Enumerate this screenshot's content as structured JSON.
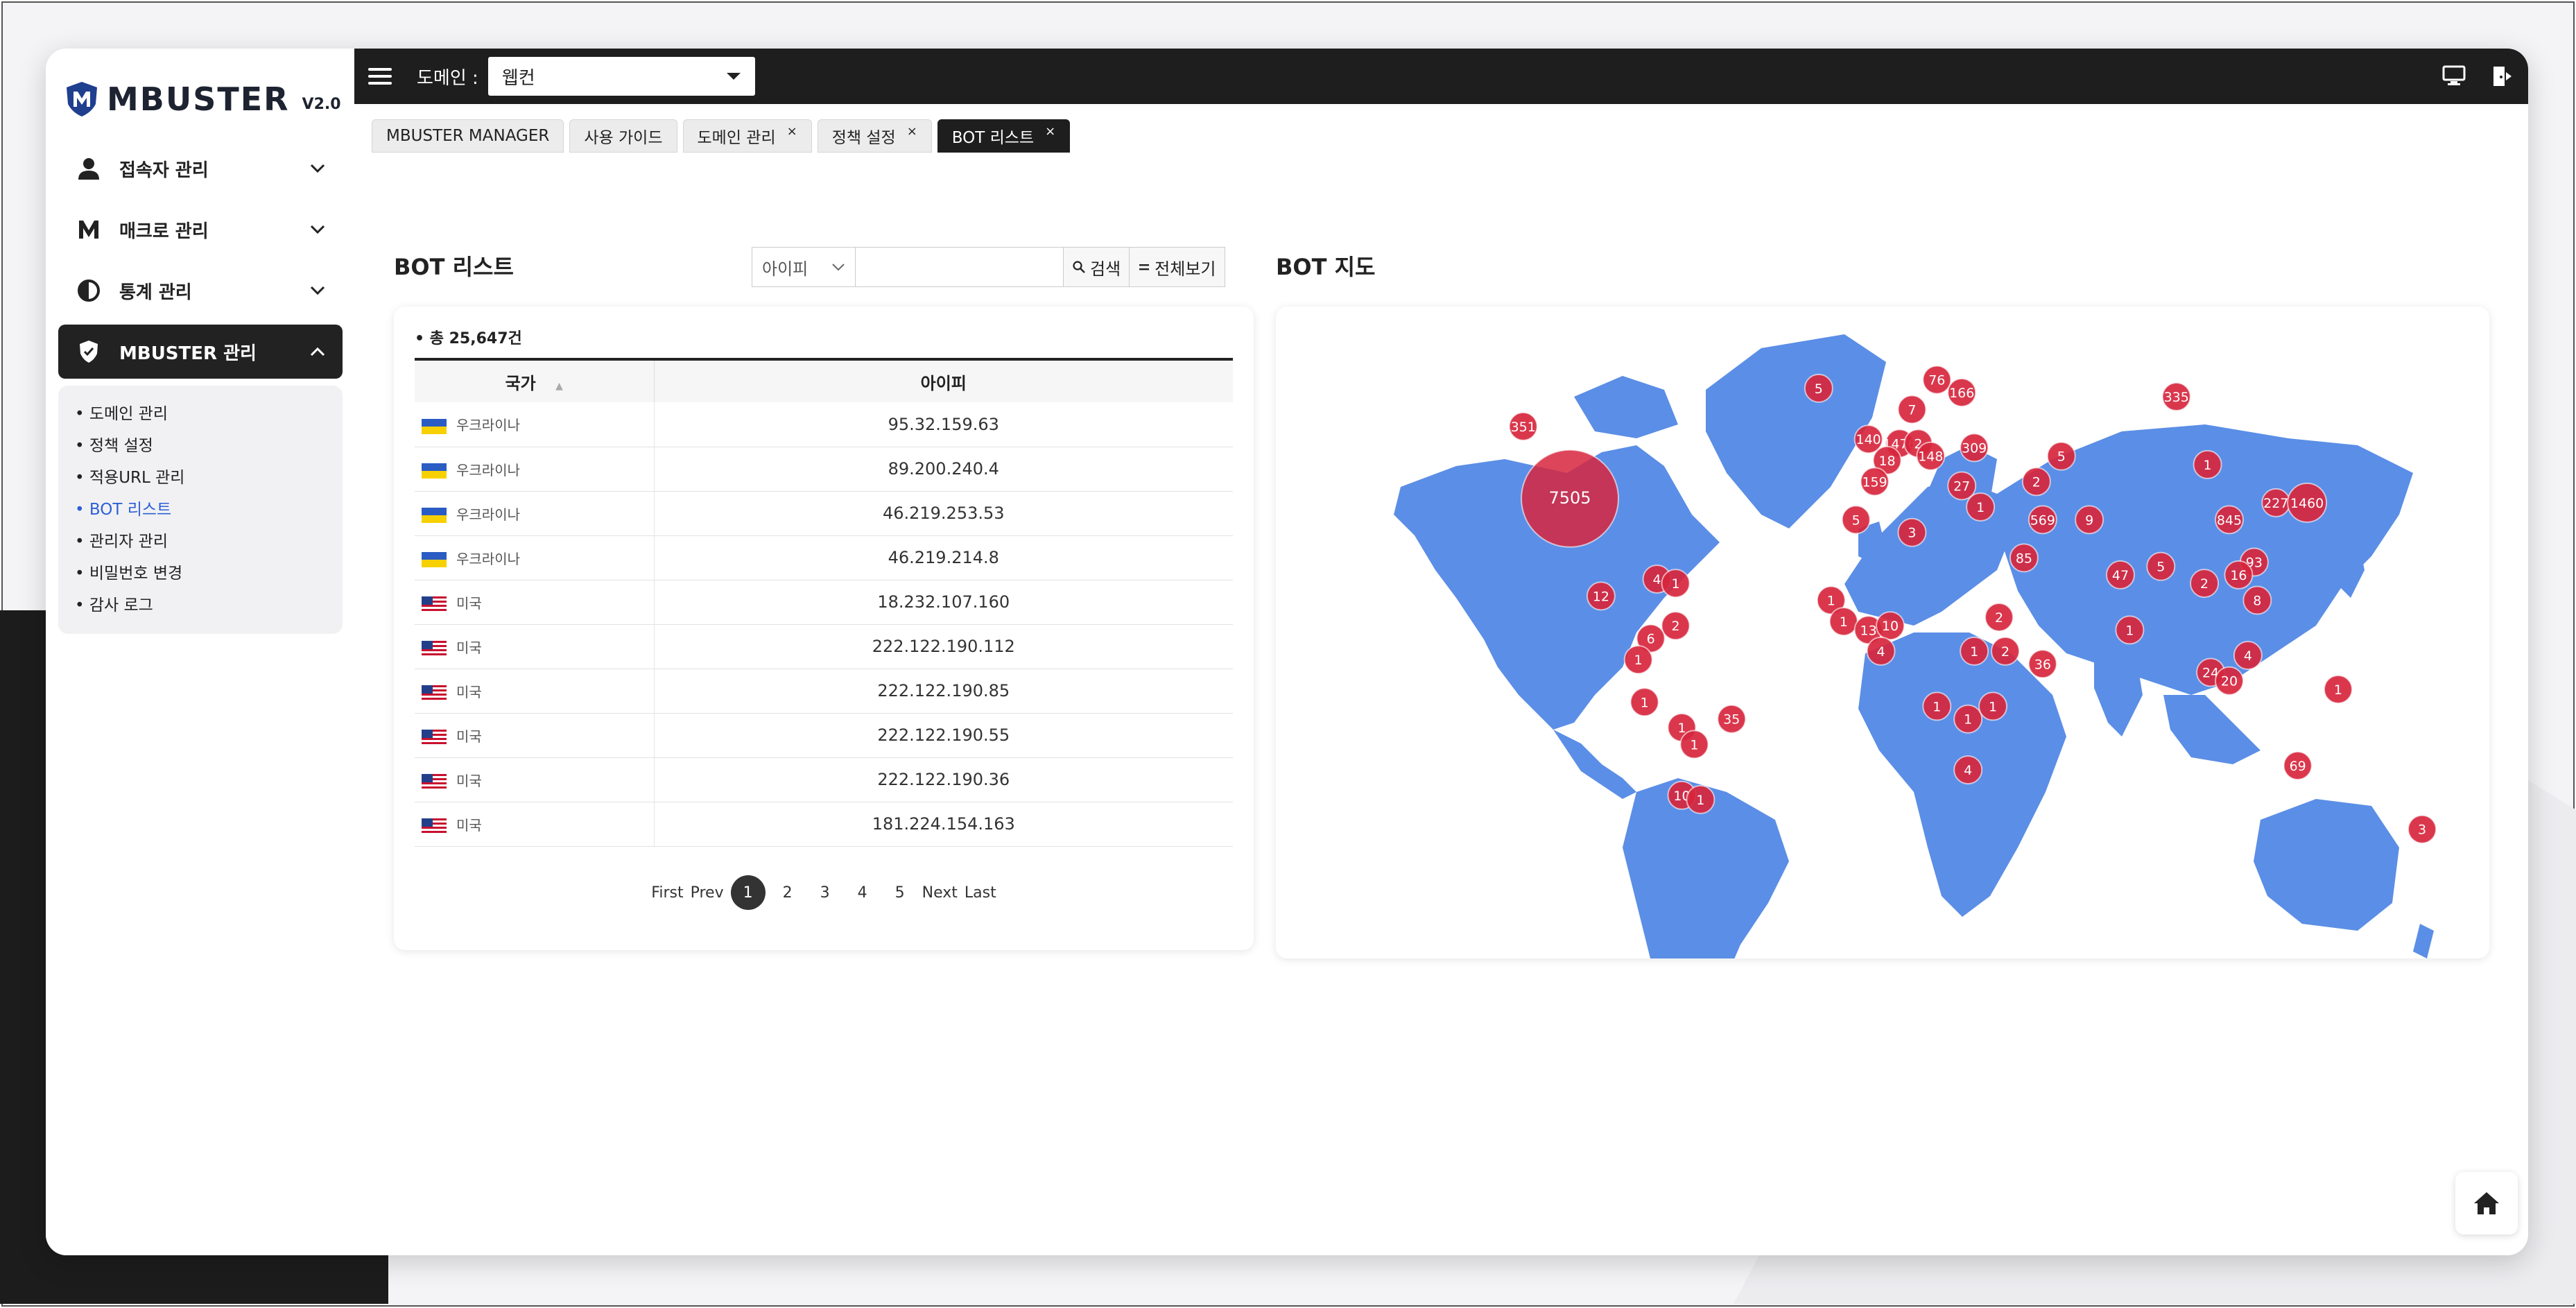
{
  "app": {
    "logo_text": "MBUSTER",
    "logo_version": "V2.0"
  },
  "sidebar": {
    "items": [
      {
        "label": "접속자 관리",
        "icon": "user-icon"
      },
      {
        "label": "매크로 관리",
        "icon": "m-letter-icon"
      },
      {
        "label": "통계 관리",
        "icon": "pie-chart-icon"
      },
      {
        "label": "MBUSTER 관리",
        "icon": "shield-icon",
        "active": true
      }
    ],
    "submenu": [
      "• 도메인 관리",
      "• 정책 설정",
      "• 적용URL 관리",
      "• BOT 리스트",
      "• 관리자 관리",
      "• 비밀번호 변경",
      "• 감사 로그"
    ],
    "submenu_active_index": 3
  },
  "topbar": {
    "domain_label": "도메인 :",
    "domain_value": "웹컨"
  },
  "tabs": [
    {
      "label": "MBUSTER MANAGER",
      "closable": false
    },
    {
      "label": "사용 가이드",
      "closable": false
    },
    {
      "label": "도메인 관리",
      "closable": true
    },
    {
      "label": "정책 설정",
      "closable": true
    },
    {
      "label": "BOT 리스트",
      "closable": true,
      "active": true
    }
  ],
  "tab_close_glyph": "×",
  "bot_list": {
    "title": "BOT 리스트",
    "search_select": "아이피",
    "search_placeholder": "",
    "search_button": "검색",
    "view_all_button": "전체보기",
    "total": "• 총 25,647건",
    "columns": [
      "국가",
      "아이피"
    ],
    "rows": [
      {
        "country": "우크라이나",
        "flag": "ua",
        "ip": "95.32.159.63"
      },
      {
        "country": "우크라이나",
        "flag": "ua",
        "ip": "89.200.240.4"
      },
      {
        "country": "우크라이나",
        "flag": "ua",
        "ip": "46.219.253.53"
      },
      {
        "country": "우크라이나",
        "flag": "ua",
        "ip": "46.219.214.8"
      },
      {
        "country": "미국",
        "flag": "us",
        "ip": "18.232.107.160"
      },
      {
        "country": "미국",
        "flag": "us",
        "ip": "222.122.190.112"
      },
      {
        "country": "미국",
        "flag": "us",
        "ip": "222.122.190.85"
      },
      {
        "country": "미국",
        "flag": "us",
        "ip": "222.122.190.55"
      },
      {
        "country": "미국",
        "flag": "us",
        "ip": "222.122.190.36"
      },
      {
        "country": "미국",
        "flag": "us",
        "ip": "181.224.154.163"
      }
    ],
    "pager": {
      "first": "First",
      "prev": "Prev",
      "pages": [
        "1",
        "2",
        "3",
        "4",
        "5"
      ],
      "current": "1",
      "next": "Next",
      "last": "Last"
    }
  },
  "bot_map": {
    "title": "BOT 지도",
    "land_color": "#5b8ee6",
    "marker_color": "#d7263d",
    "clusters": [
      {
        "label": "7505",
        "lon": -100,
        "lat": 38,
        "size": "large"
      },
      {
        "label": "351",
        "lon": -115,
        "lat": 55,
        "size": "small"
      },
      {
        "label": "5",
        "lon": -20,
        "lat": 64,
        "size": "small"
      },
      {
        "label": "76",
        "lon": 18,
        "lat": 66,
        "size": "small"
      },
      {
        "label": "166",
        "lon": 26,
        "lat": 63,
        "size": "small"
      },
      {
        "label": "7",
        "lon": 10,
        "lat": 59,
        "size": "small"
      },
      {
        "label": "335",
        "lon": 95,
        "lat": 62,
        "size": "small"
      },
      {
        "label": "140",
        "lon": -4,
        "lat": 52,
        "size": "small"
      },
      {
        "label": "1476",
        "lon": 6,
        "lat": 51,
        "size": "small"
      },
      {
        "label": "2",
        "lon": 12,
        "lat": 51,
        "size": "small"
      },
      {
        "label": "309",
        "lon": 30,
        "lat": 50,
        "size": "small"
      },
      {
        "label": "148",
        "lon": 16,
        "lat": 48,
        "size": "small"
      },
      {
        "label": "18",
        "lon": 2,
        "lat": 47,
        "size": "small"
      },
      {
        "label": "159",
        "lon": -2,
        "lat": 42,
        "size": "small"
      },
      {
        "label": "27",
        "lon": 26,
        "lat": 41,
        "size": "small"
      },
      {
        "label": "5",
        "lon": 58,
        "lat": 48,
        "size": "small"
      },
      {
        "label": "2",
        "lon": 50,
        "lat": 42,
        "size": "small"
      },
      {
        "label": "1",
        "lon": 105,
        "lat": 46,
        "size": "small"
      },
      {
        "label": "5",
        "lon": -8,
        "lat": 33,
        "size": "small"
      },
      {
        "label": "3",
        "lon": 10,
        "lat": 30,
        "size": "small"
      },
      {
        "label": "1",
        "lon": 32,
        "lat": 36,
        "size": "small"
      },
      {
        "label": "569",
        "lon": 52,
        "lat": 33,
        "size": "small"
      },
      {
        "label": "9",
        "lon": 67,
        "lat": 33,
        "size": "small"
      },
      {
        "label": "845",
        "lon": 112,
        "lat": 33,
        "size": "small"
      },
      {
        "label": "227",
        "lon": 127,
        "lat": 37,
        "size": "small"
      },
      {
        "label": "1460",
        "lon": 137,
        "lat": 37,
        "size": "medium"
      },
      {
        "label": "85",
        "lon": 46,
        "lat": 24,
        "size": "small"
      },
      {
        "label": "47",
        "lon": 77,
        "lat": 20,
        "size": "small"
      },
      {
        "label": "5",
        "lon": 90,
        "lat": 22,
        "size": "small"
      },
      {
        "label": "93",
        "lon": 120,
        "lat": 23,
        "size": "small"
      },
      {
        "label": "16",
        "lon": 115,
        "lat": 20,
        "size": "small"
      },
      {
        "label": "2",
        "lon": 104,
        "lat": 18,
        "size": "small"
      },
      {
        "label": "8",
        "lon": 121,
        "lat": 14,
        "size": "small"
      },
      {
        "label": "1",
        "lon": 80,
        "lat": 7,
        "size": "small"
      },
      {
        "label": "24",
        "lon": 106,
        "lat": -3,
        "size": "small"
      },
      {
        "label": "20",
        "lon": 112,
        "lat": -5,
        "size": "small"
      },
      {
        "label": "4",
        "lon": 118,
        "lat": 1,
        "size": "small"
      },
      {
        "label": "1",
        "lon": 147,
        "lat": -7,
        "size": "small"
      },
      {
        "label": "69",
        "lon": 134,
        "lat": -25,
        "size": "small"
      },
      {
        "label": "3",
        "lon": 174,
        "lat": -40,
        "size": "small"
      },
      {
        "label": "4",
        "lon": -72,
        "lat": 19,
        "size": "small"
      },
      {
        "label": "1",
        "lon": -66,
        "lat": 18,
        "size": "small"
      },
      {
        "label": "12",
        "lon": -90,
        "lat": 15,
        "size": "small"
      },
      {
        "label": "2",
        "lon": -66,
        "lat": 8,
        "size": "small"
      },
      {
        "label": "6",
        "lon": -74,
        "lat": 5,
        "size": "small"
      },
      {
        "label": "1",
        "lon": -78,
        "lat": 0,
        "size": "small"
      },
      {
        "label": "1",
        "lon": -76,
        "lat": -10,
        "size": "small"
      },
      {
        "label": "1",
        "lon": -64,
        "lat": -16,
        "size": "small"
      },
      {
        "label": "1",
        "lon": -60,
        "lat": -20,
        "size": "small"
      },
      {
        "label": "35",
        "lon": -48,
        "lat": -14,
        "size": "small"
      },
      {
        "label": "10",
        "lon": -64,
        "lat": -32,
        "size": "small"
      },
      {
        "label": "1",
        "lon": -58,
        "lat": -33,
        "size": "small"
      },
      {
        "label": "1",
        "lon": -16,
        "lat": 14,
        "size": "small"
      },
      {
        "label": "1",
        "lon": -12,
        "lat": 9,
        "size": "small"
      },
      {
        "label": "13",
        "lon": -4,
        "lat": 7,
        "size": "small"
      },
      {
        "label": "10",
        "lon": 3,
        "lat": 8,
        "size": "small"
      },
      {
        "label": "4",
        "lon": 0,
        "lat": 2,
        "size": "small"
      },
      {
        "label": "2",
        "lon": 38,
        "lat": 10,
        "size": "small"
      },
      {
        "label": "1",
        "lon": 30,
        "lat": 2,
        "size": "small"
      },
      {
        "label": "2",
        "lon": 40,
        "lat": 2,
        "size": "small"
      },
      {
        "label": "36",
        "lon": 52,
        "lat": -1,
        "size": "small"
      },
      {
        "label": "1",
        "lon": 18,
        "lat": -11,
        "size": "small"
      },
      {
        "label": "1",
        "lon": 28,
        "lat": -14,
        "size": "small"
      },
      {
        "label": "1",
        "lon": 36,
        "lat": -11,
        "size": "small"
      },
      {
        "label": "4",
        "lon": 28,
        "lat": -26,
        "size": "small"
      }
    ]
  }
}
